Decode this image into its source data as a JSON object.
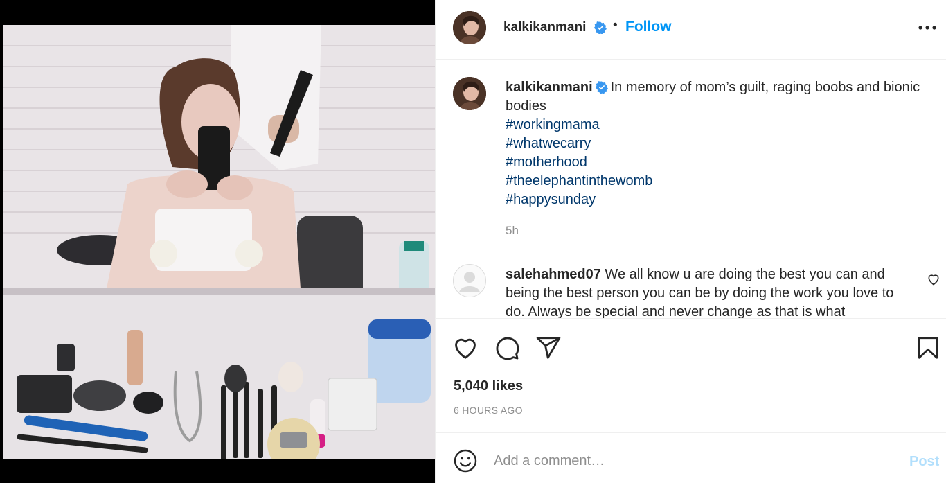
{
  "post": {
    "author": "kalkikanmani",
    "follow_label": "Follow",
    "separator": "•",
    "caption_text": "In memory of mom’s guilt, raging boobs and bionic bodies",
    "hashtags": [
      "#workingmama",
      "#whatwecarry",
      "#motherhood",
      "#theelephantinthewomb",
      "#happysunday"
    ],
    "time_ago": "5h",
    "likes": "5,040 likes",
    "timestamp": "6 HOURS AGO"
  },
  "comments": [
    {
      "username": "salehahmed07",
      "text": "We all know u are doing the best you can and being the best person you can be by doing the work you love to do. Always be special and never change as that is what"
    }
  ],
  "add_comment": {
    "placeholder": "Add a comment…",
    "post_label": "Post"
  },
  "icons": {
    "verified": "verified-badge-icon",
    "more": "more-options-icon",
    "like": "heart-icon",
    "comment": "comment-bubble-icon",
    "share": "paper-plane-icon",
    "save": "bookmark-icon",
    "emoji": "emoji-icon"
  },
  "colors": {
    "accent": "#0095f6",
    "hashtag": "#00376b",
    "muted": "#8e8e8e",
    "post_disabled": "#b2dffc",
    "verified": "#3897f0"
  }
}
